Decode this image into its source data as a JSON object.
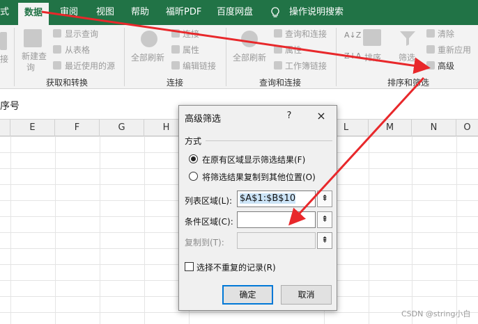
{
  "tabs": [
    "式",
    "数据",
    "审阅",
    "视图",
    "帮助",
    "福昕PDF",
    "百度网盘",
    "操作说明搜索"
  ],
  "ribbon": {
    "get_transform": {
      "partial_label": "接",
      "new_query_line1": "新建查",
      "new_query_line2": "询",
      "items": [
        "显示查询",
        "从表格",
        "最近使用的源"
      ],
      "group_label": "获取和转换"
    },
    "connections": {
      "refresh_all_line1": "全部刷新",
      "items": [
        "连接",
        "属性",
        "编辑链接"
      ],
      "group_label": "连接"
    },
    "queries": {
      "refresh_all_line1": "全部刷新",
      "items": [
        "查询和连接",
        "属性",
        "工作簿链接"
      ],
      "group_label": "查询和连接"
    },
    "sort_filter": {
      "sort": "排序",
      "filter": "筛选",
      "items": [
        "清除",
        "重新应用",
        "高级"
      ],
      "group_label": "排序和筛选"
    }
  },
  "formula_bar": {
    "text": "序号"
  },
  "columns": [
    "E",
    "F",
    "G",
    "H",
    "L",
    "M",
    "N",
    "O"
  ],
  "dialog": {
    "title": "高级筛选",
    "help": "?",
    "close": "×",
    "section_label": "方式",
    "radio1": "在原有区域显示筛选结果(F)",
    "radio2": "将筛选结果复制到其他位置(O)",
    "list_range_label": "列表区域(L):",
    "list_range_value": "$A$1:$B$10",
    "criteria_label": "条件区域(C):",
    "criteria_value": "",
    "copy_to_label": "复制到(T):",
    "copy_to_value": "",
    "unique_label": "选择不重复的记录(R)",
    "ok": "确定",
    "cancel": "取消"
  },
  "watermark": "CSDN @string小白",
  "colors": {
    "excel_green": "#217346",
    "arrow_red": "#e8282b",
    "focus_blue": "#0078d7"
  }
}
